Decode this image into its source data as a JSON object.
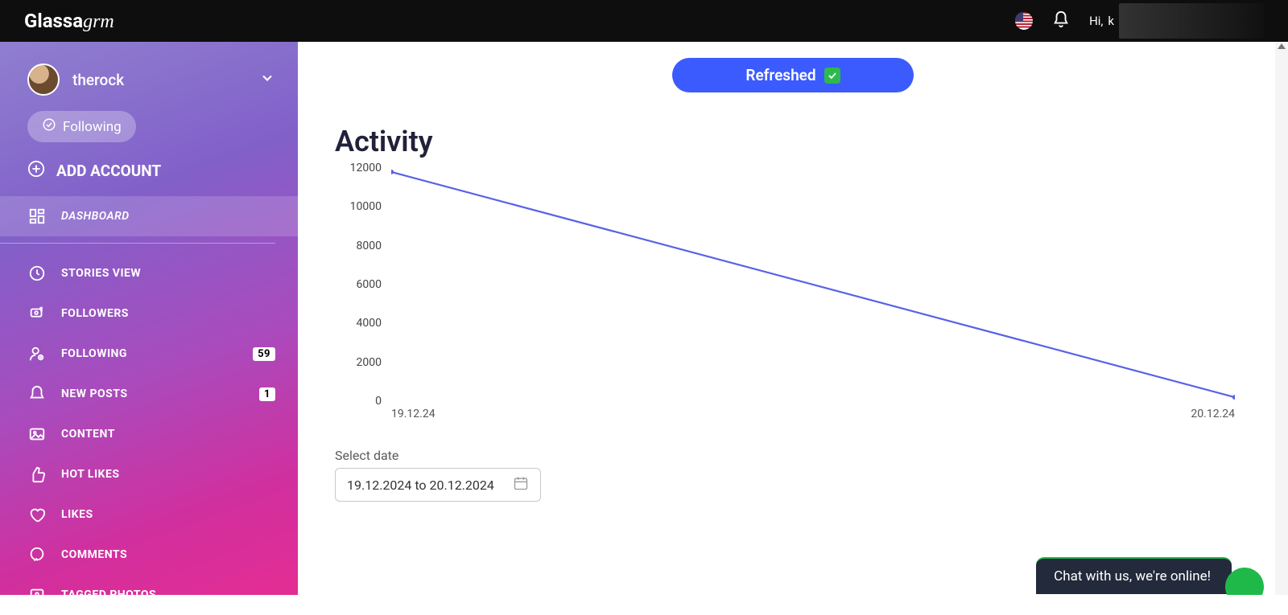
{
  "header": {
    "logo_main": "Glassa",
    "logo_thin": "grm",
    "greeting_prefix": "Hi,",
    "greeting_initial": "k"
  },
  "sidebar": {
    "account_name": "therock",
    "following_pill": "Following",
    "add_account": "ADD ACCOUNT",
    "items": [
      {
        "label": "DASHBOARD",
        "active": true
      },
      {
        "label": "STORIES VIEW"
      },
      {
        "label": "FOLLOWERS"
      },
      {
        "label": "FOLLOWING",
        "badge": "59"
      },
      {
        "label": "NEW POSTS",
        "badge": "1"
      },
      {
        "label": "CONTENT"
      },
      {
        "label": "HOT LIKES"
      },
      {
        "label": "LIKES"
      },
      {
        "label": "COMMENTS"
      },
      {
        "label": "TAGGED PHOTOS"
      }
    ]
  },
  "main": {
    "refreshed_label": "Refreshed",
    "activity_title": "Activity",
    "select_date_label": "Select date",
    "date_range_value": "19.12.2024 to 20.12.2024"
  },
  "chat": {
    "text": "Chat with us, we're online!"
  },
  "chart_data": {
    "type": "line",
    "title": "Activity",
    "xlabel": "",
    "ylabel": "",
    "ylim": [
      0,
      12000
    ],
    "y_ticks": [
      12000,
      10000,
      8000,
      6000,
      4000,
      2000,
      0
    ],
    "x_ticks": [
      "19.12.24",
      "20.12.24"
    ],
    "categories": [
      "19.12.24",
      "20.12.24"
    ],
    "values": [
      11800,
      200
    ],
    "line_color": "#5862e8"
  }
}
